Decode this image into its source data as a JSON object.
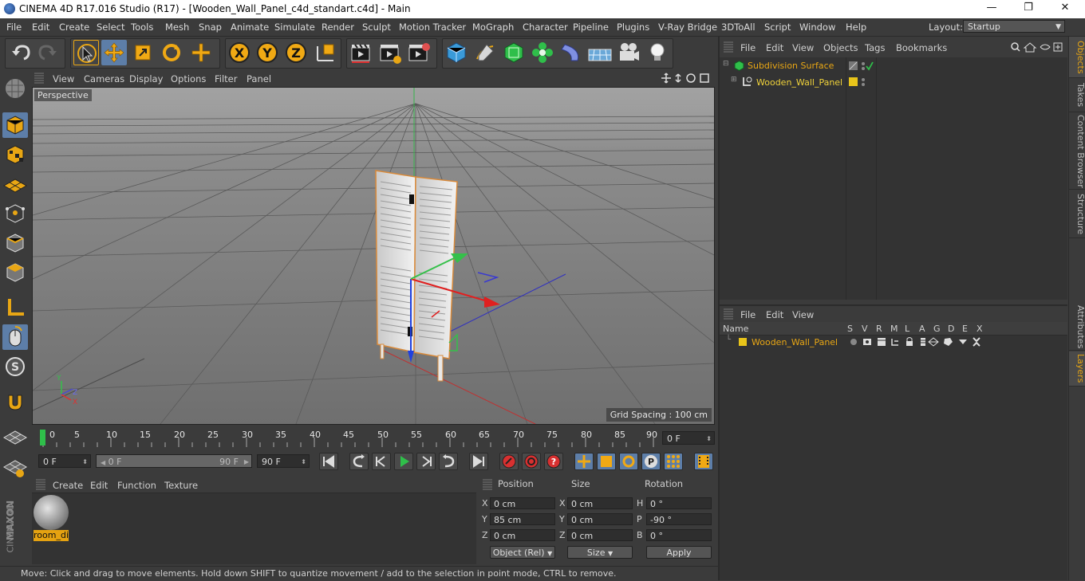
{
  "window": {
    "title": "CINEMA 4D R17.016 Studio (R17) - [Wooden_Wall_Panel_c4d_standart.c4d] - Main",
    "minimize_glyph": "—",
    "restore_glyph": "❐",
    "close_glyph": "✕"
  },
  "menu": {
    "items": [
      "File",
      "Edit",
      "Create",
      "Select",
      "Tools",
      "Mesh",
      "Snap",
      "Animate",
      "Simulate",
      "Render",
      "Sculpt",
      "Motion Tracker",
      "MoGraph",
      "Character",
      "Pipeline",
      "Plugins",
      "V-Ray Bridge",
      "3DToAll",
      "Script",
      "Window",
      "Help"
    ],
    "layout_label": "Layout:",
    "layout_value": "Startup"
  },
  "viewport": {
    "menu": [
      "View",
      "Cameras",
      "Display",
      "Options",
      "Filter",
      "Panel"
    ],
    "camera_label": "Perspective",
    "grid_spacing": "Grid Spacing : 100 cm",
    "axis_labels": {
      "y": "Y",
      "z": "Z",
      "x": "X"
    }
  },
  "timeline": {
    "ticks": [
      "0",
      "5",
      "10",
      "15",
      "20",
      "25",
      "30",
      "35",
      "40",
      "45",
      "50",
      "55",
      "60",
      "65",
      "70",
      "75",
      "80",
      "85",
      "90"
    ],
    "current_frame": "0 F"
  },
  "transport": {
    "start_field": "0 F",
    "range_start": "0 F",
    "range_end": "90 F",
    "end_field": "90 F"
  },
  "material_manager": {
    "menu": [
      "Create",
      "Edit",
      "Function",
      "Texture"
    ],
    "materials": [
      {
        "name": "room_di"
      }
    ]
  },
  "coordinates": {
    "headers": {
      "position": "Position",
      "size": "Size",
      "rotation": "Rotation"
    },
    "rows": [
      {
        "axis": "X",
        "position": "0 cm",
        "size_axis": "X",
        "size": "0 cm",
        "rot_axis": "H",
        "rotation": "0 °"
      },
      {
        "axis": "Y",
        "position": "85 cm",
        "size_axis": "Y",
        "size": "0 cm",
        "rot_axis": "P",
        "rotation": "-90 °"
      },
      {
        "axis": "Z",
        "position": "0 cm",
        "size_axis": "Z",
        "size": "0 cm",
        "rot_axis": "B",
        "rotation": "0 °"
      }
    ],
    "mode_select": "Object (Rel)",
    "size_select": "Size",
    "apply_label": "Apply"
  },
  "status": {
    "text": "Move: Click and drag to move elements. Hold down SHIFT to quantize movement / add to the selection in point mode, CTRL to remove."
  },
  "object_manager": {
    "menu": [
      "File",
      "Edit",
      "View",
      "Objects",
      "Tags",
      "Bookmarks"
    ],
    "objects": [
      {
        "name": "Subdivision Surface",
        "color": "#e8a614"
      },
      {
        "name": "Wooden_Wall_Panel",
        "color": "#f0d23a"
      }
    ]
  },
  "layer_manager": {
    "menu": [
      "File",
      "Edit",
      "View"
    ],
    "columns": [
      "Name",
      "S",
      "V",
      "R",
      "M",
      "L",
      "A",
      "G",
      "D",
      "E",
      "X"
    ],
    "layers": [
      {
        "name": "Wooden_Wall_Panel",
        "color": "#e8c41a"
      }
    ]
  },
  "side_tabs": {
    "top": [
      "Objects",
      "Takes",
      "Content Browser",
      "Structure"
    ],
    "bottom": [
      "Attributes",
      "Layers"
    ]
  },
  "branding": {
    "maxon": "MAXON",
    "product": "CINEMA 4D"
  },
  "colors": {
    "accent": "#e8a614",
    "selected_tool": "#5d7ea8"
  }
}
